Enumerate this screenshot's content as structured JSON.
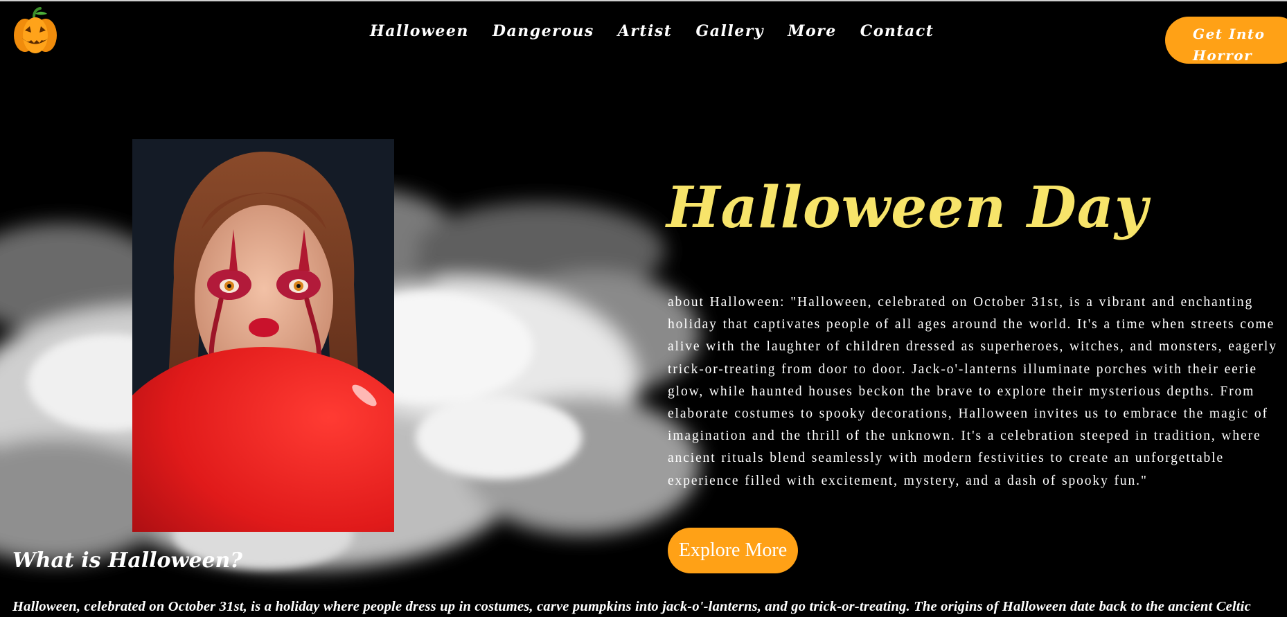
{
  "header": {
    "logo_icon": "jack-o-lantern-icon",
    "nav": [
      "Halloween",
      "Dangerous",
      "Artist",
      "Gallery",
      "More",
      "Contact"
    ],
    "cta_label": "Get Into Horror"
  },
  "hero": {
    "title": "Halloween Day",
    "description": "about Halloween: \"Halloween, celebrated on October 31st, is a vibrant and enchanting holiday that captivates people of all ages around the world. It's a time when streets come alive with the laughter of children dressed as superheroes, witches, and monsters, eagerly trick-or-treating from door to door. Jack-o'-lanterns illuminate porches with their eerie glow, while haunted houses beckon the brave to explore their mysterious depths. From elaborate costumes to spooky decorations, Halloween invites us to embrace the magic of imagination and the thrill of the unknown. It's a celebration steeped in tradition, where ancient rituals blend seamlessly with modern festivities to create an unforgettable experience filled with excitement, mystery, and a dash of spooky fun.\"",
    "button_label": "Explore More",
    "photo": "clown-makeup-woman-red-balloon"
  },
  "section": {
    "heading": "What is Halloween?",
    "text": "Halloween, celebrated on October 31st, is a holiday where people dress up in costumes, carve pumpkins into jack-o'-lanterns, and go trick-or-treating. The origins of Halloween date back to the ancient Celtic"
  },
  "colors": {
    "background": "#000000",
    "accent": "#ffa116",
    "title": "#f7e46a",
    "text": "#ffffff"
  }
}
